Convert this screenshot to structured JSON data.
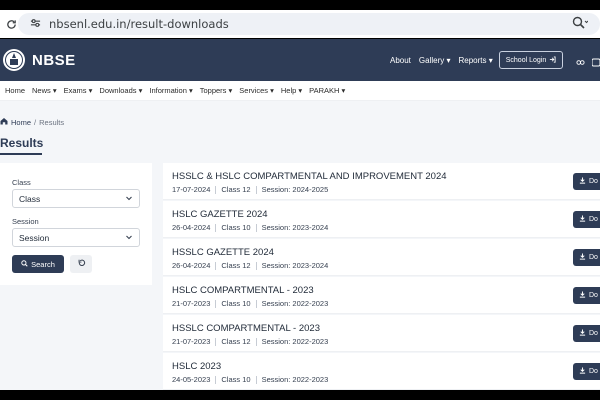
{
  "browser": {
    "url": "nbsenl.edu.in/result-downloads"
  },
  "header": {
    "brand": "NBSE",
    "nav": [
      "About",
      "Gallery ▾",
      "Reports ▾"
    ],
    "school_login": "School Login"
  },
  "main_nav": [
    "Home",
    "News ▾",
    "Exams ▾",
    "Downloads ▾",
    "Information ▾",
    "Toppers ▾",
    "Services ▾",
    "Help ▾",
    "PARAKH ▾"
  ],
  "breadcrumb": {
    "home": "Home",
    "sep": "/",
    "current": "Results"
  },
  "page_title": "Results",
  "filter": {
    "class_label": "Class",
    "class_value": "Class",
    "session_label": "Session",
    "session_value": "Session",
    "search_label": "Search"
  },
  "results": [
    {
      "title": "HSSLC & HSLC COMPARTMENTAL AND IMPROVEMENT 2024",
      "date": "17-07-2024",
      "class": "Class 12",
      "session": "Session: 2024-2025"
    },
    {
      "title": "HSLC GAZETTE 2024",
      "date": "26-04-2024",
      "class": "Class 10",
      "session": "Session: 2023-2024"
    },
    {
      "title": "HSSLC GAZETTE 2024",
      "date": "26-04-2024",
      "class": "Class 12",
      "session": "Session: 2023-2024"
    },
    {
      "title": "HSLC COMPARTMENTAL - 2023",
      "date": "21-07-2023",
      "class": "Class 10",
      "session": "Session: 2022-2023"
    },
    {
      "title": "HSSLC COMPARTMENTAL - 2023",
      "date": "21-07-2023",
      "class": "Class 12",
      "session": "Session: 2022-2023"
    },
    {
      "title": "HSLC 2023",
      "date": "24-05-2023",
      "class": "Class 10",
      "session": "Session: 2022-2023"
    }
  ],
  "download_label": "Do",
  "colors": {
    "brand": "#2e3c56",
    "page_bg": "#f4f6f9"
  }
}
